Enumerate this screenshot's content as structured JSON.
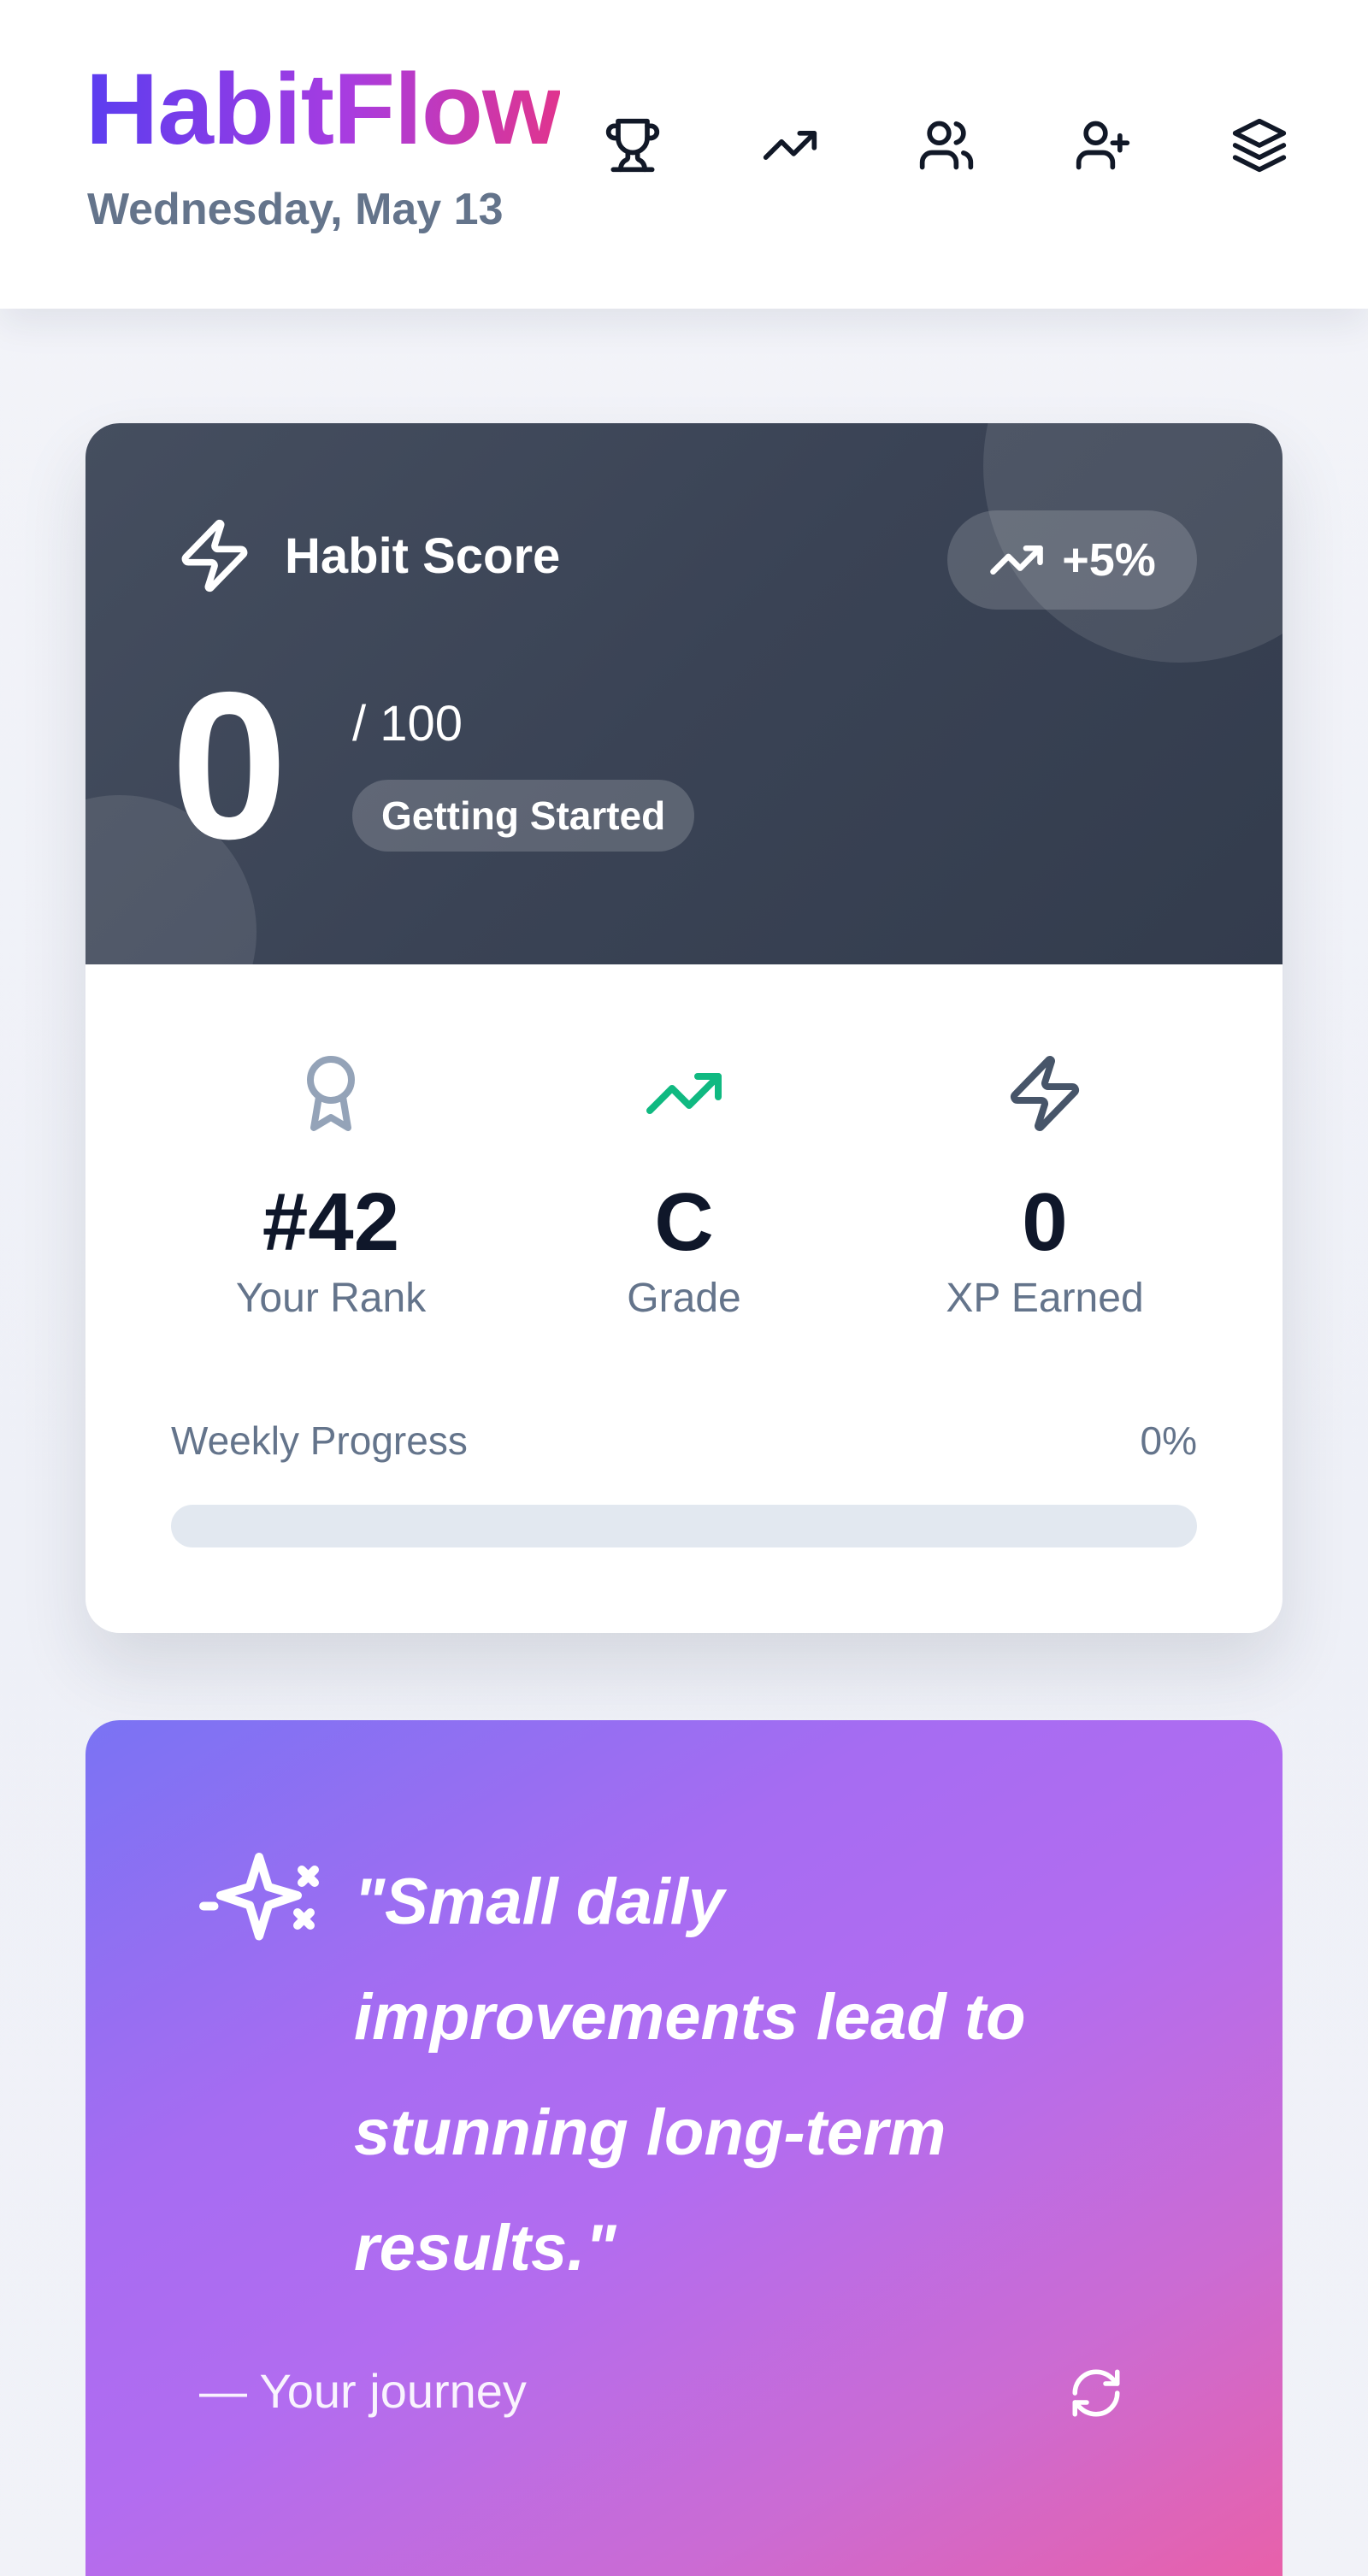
{
  "header": {
    "app_name": "HabitFlow",
    "date": "Wednesday, May 13",
    "nav_icons": [
      "trophy-icon",
      "trending-up-icon",
      "users-icon",
      "user-plus-icon",
      "layers-icon"
    ]
  },
  "score_card": {
    "title": "Habit Score",
    "trend": "+5%",
    "score": "0",
    "out_of": "/ 100",
    "level": "Getting Started",
    "stats": [
      {
        "icon": "award-icon",
        "value": "#42",
        "label": "Your Rank",
        "color": "#94a3b8"
      },
      {
        "icon": "trending-up-icon",
        "value": "C",
        "label": "Grade",
        "color": "#10b981"
      },
      {
        "icon": "zap-icon",
        "value": "0",
        "label": "XP Earned",
        "color": "#475569"
      }
    ],
    "weekly_progress": {
      "label": "Weekly Progress",
      "value_text": "0%",
      "value": 0
    }
  },
  "quote_card": {
    "quote": "\"Small daily improvements lead to stunning long-term results.\"",
    "attribution": "— Your journey"
  },
  "colors": {
    "brand_gradient_start": "#5b3df0",
    "brand_gradient_end": "#e0348e",
    "score_bg": "#3a4355",
    "quote_gradient_start": "#7a73f3",
    "quote_gradient_end": "#ec5fa4"
  }
}
